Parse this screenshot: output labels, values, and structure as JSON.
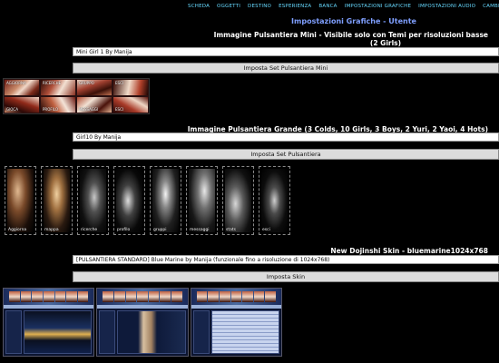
{
  "topnav": [
    "scheda",
    "oggetti",
    "destino",
    "esperienza",
    "banca",
    "impostazioni grafiche",
    "impostazioni audio",
    "cambia prof"
  ],
  "page_title": "Impostazioni Grafiche - Utente",
  "mini_toolbar": {
    "heading_line1": "Immagine Pulsantiera Mini - Visibile solo con Temi per risoluzioni basse",
    "heading_line2": "(2 Girls)",
    "selected_value": "Mini Girl 1 By Manija",
    "button_label": "Imposta Set Pulsantiera Mini",
    "labels": [
      "aggiorna",
      "ricerche",
      "gruppo",
      "esci",
      "gioca",
      "profilo",
      "messaggi",
      "esci"
    ]
  },
  "large_toolbar": {
    "heading": "Immagine Pulsantiera Grande (3 Colds, 10 Girls, 3 Boys, 2 Yuri, 2 Yaoi, 4 Hots)",
    "selected_value": "Girl10 By Manija",
    "button_label": "Imposta Set Pulsantiera",
    "labels": [
      "Aggiorna",
      "mappa",
      "ricerche",
      "profilo",
      "gruppi",
      "messaggi",
      "stats",
      "esci"
    ]
  },
  "skin": {
    "heading": "New Dojinshi Skin - bluemarine1024x768",
    "selected_value": "[PULSANTIERA STANDARD] Blue Marine by Manija (funzionale fino a risoluzione di 1024x768)",
    "button_label": "Imposta Skin"
  }
}
